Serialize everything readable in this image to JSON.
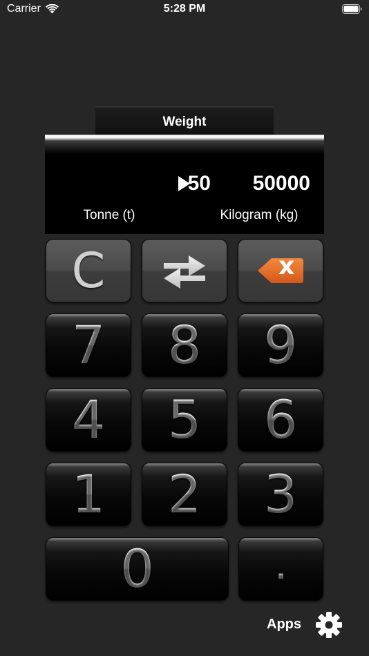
{
  "status_bar": {
    "carrier": "Carrier",
    "time": "5:28 PM",
    "icons": [
      "wifi-icon",
      "battery-icon"
    ]
  },
  "converter": {
    "category": "Weight",
    "from_value": "50",
    "to_value": "50000",
    "from_unit": "Tonne (t)",
    "to_unit": "Kilogram (kg)",
    "direction_icon": "arrow-right-icon"
  },
  "keypad": {
    "clear": "C",
    "swap_icon": "swap-arrows-icon",
    "backspace_icon": "backspace-icon",
    "backspace_glyph": "x",
    "digits": {
      "seven": "7",
      "eight": "8",
      "nine": "9",
      "four": "4",
      "five": "5",
      "six": "6",
      "one": "1",
      "two": "2",
      "three": "3",
      "zero": "0"
    },
    "decimal": "."
  },
  "footer": {
    "apps_label": "Apps",
    "settings_icon": "gear-icon"
  },
  "colors": {
    "background": "#262626",
    "display": "#000000",
    "backspace_accent": "#e8702a"
  }
}
